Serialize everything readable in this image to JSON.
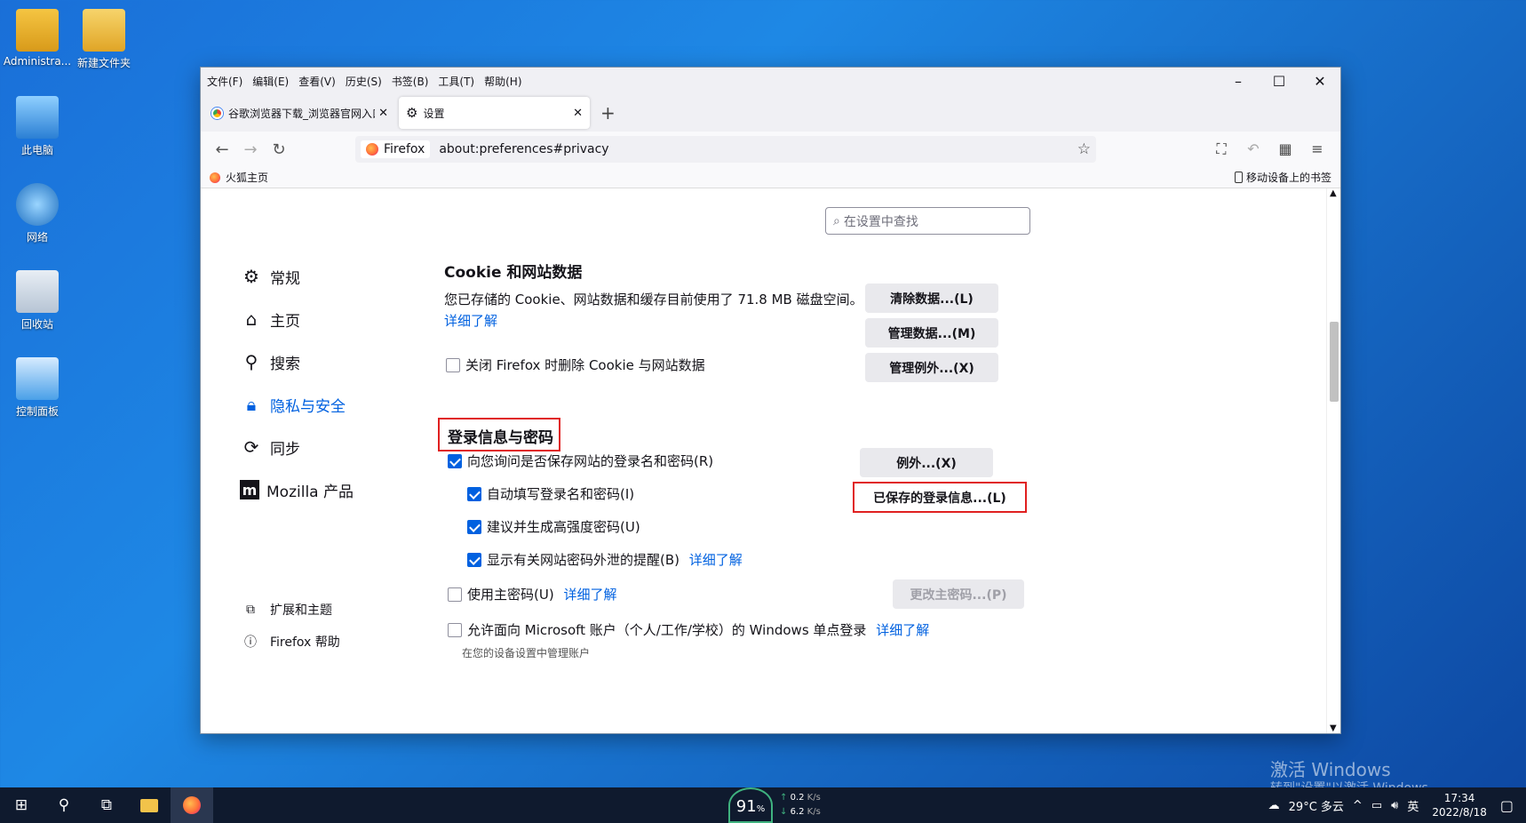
{
  "desktop": {
    "icons": [
      {
        "label": "Administra..."
      },
      {
        "label": "新建文件夹"
      },
      {
        "label": "此电脑"
      },
      {
        "label": "网络"
      },
      {
        "label": "回收站"
      },
      {
        "label": "控制面板"
      }
    ],
    "watermark_line1": "激活 Windows",
    "watermark_line2": "转到\"设置\"以激活 Windows。"
  },
  "browser": {
    "menu": [
      "文件(F)",
      "编辑(E)",
      "查看(V)",
      "历史(S)",
      "书签(B)",
      "工具(T)",
      "帮助(H)"
    ],
    "tabs": [
      {
        "title": "谷歌浏览器下载_浏览器官网入口"
      },
      {
        "title": "设置"
      }
    ],
    "url_chip": "Firefox",
    "url": "about:preferences#privacy",
    "bookmark": "火狐主页",
    "mobile_bookmarks": "移动设备上的书签"
  },
  "prefs": {
    "search_placeholder": "在设置中查找",
    "nav": [
      "常规",
      "主页",
      "搜索",
      "隐私与安全",
      "同步",
      "Mozilla 产品"
    ],
    "nav_footer": [
      "扩展和主题",
      "Firefox 帮助"
    ],
    "cookie": {
      "title": "Cookie 和网站数据",
      "desc": "您已存储的 Cookie、网站数据和缓存目前使用了 71.8 MB 磁盘空间。",
      "learn_more": "详细了解",
      "clear_on_close": "关闭 Firefox 时删除 Cookie 与网站数据",
      "btn_clear": "清除数据...(L)",
      "btn_manage": "管理数据...(M)",
      "btn_exceptions": "管理例外...(X)"
    },
    "logins": {
      "title": "登录信息与密码",
      "ask_save": "向您询问是否保存网站的登录名和密码(R)",
      "autofill": "自动填写登录名和密码(I)",
      "suggest": "建议并生成高强度密码(U)",
      "alerts": "显示有关网站密码外泄的提醒(B)",
      "alerts_link": "详细了解",
      "primary": "使用主密码(U)",
      "primary_link": "详细了解",
      "sso": "允许面向 Microsoft 账户（个人/工作/学校）的 Windows 单点登录",
      "sso_link": "详细了解",
      "sso_sub": "在您的设备设置中管理账户",
      "btn_exceptions": "例外...(X)",
      "btn_saved": "已保存的登录信息...(L)",
      "btn_change_primary": "更改主密码...(P)"
    }
  },
  "taskbar": {
    "perf": "91",
    "perf_unit": "%",
    "net_up": "0.2",
    "net_down": "6.2",
    "net_unit": "K/s",
    "weather": "29°C 多云",
    "ime": "英",
    "time": "17:34",
    "date": "2022/8/18"
  }
}
